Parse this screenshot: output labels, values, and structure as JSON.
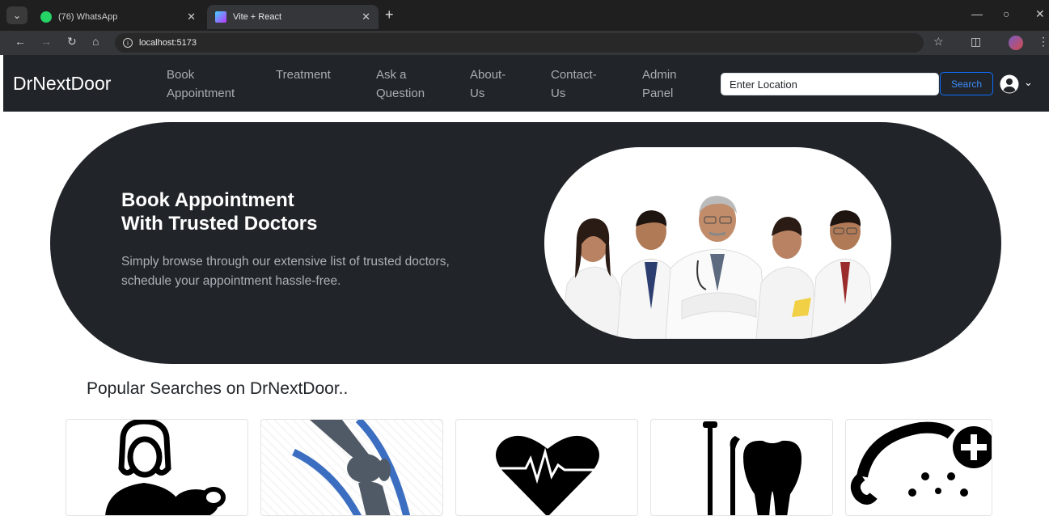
{
  "browser": {
    "tabs": [
      {
        "title": "(76) WhatsApp",
        "active": false,
        "favicon_color": "#25d366"
      },
      {
        "title": "Vite + React",
        "active": true,
        "favicon_color": "#9b6bff"
      }
    ],
    "url": "localhost:5173"
  },
  "navbar": {
    "brand": "DrNextDoor",
    "links": [
      {
        "line1": "Book",
        "line2": "Appointment"
      },
      {
        "line1": "Treatment",
        "line2": ""
      },
      {
        "line1": "Ask a",
        "line2": "Question"
      },
      {
        "line1": "About-",
        "line2": "Us"
      },
      {
        "line1": "Contact-",
        "line2": "Us"
      },
      {
        "line1": "Admin",
        "line2": "Panel"
      }
    ],
    "location_value": "Enter Location",
    "search_label": "Search"
  },
  "hero": {
    "title_line1": "Book Appointment",
    "title_line2": "With Trusted Doctors",
    "subtitle_line1": "Simply browse through our extensive list of trusted doctors,",
    "subtitle_line2": "schedule your appointment hassle-free."
  },
  "popular": {
    "title": "Popular Searches on DrNextDoor..",
    "cards": [
      {
        "icon": "woman-doctor-icon"
      },
      {
        "icon": "knee-joint-icon"
      },
      {
        "icon": "heartbeat-icon"
      },
      {
        "icon": "dental-tools-icon"
      },
      {
        "icon": "baby-care-icon"
      }
    ]
  },
  "colors": {
    "dark": "#212529",
    "link": "#a9adb2",
    "primary": "#0d6efd"
  }
}
